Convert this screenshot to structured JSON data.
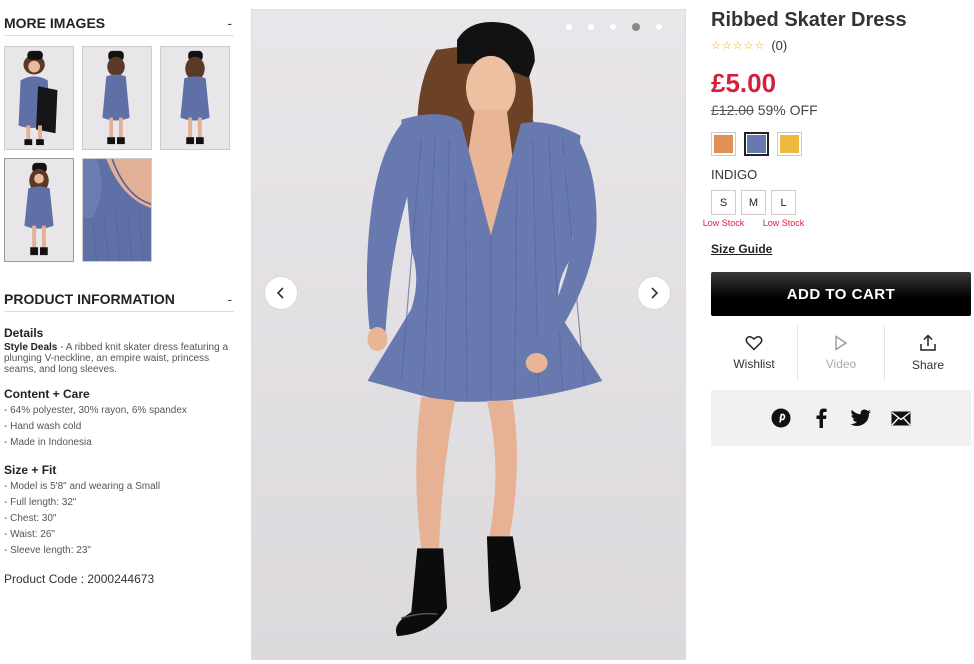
{
  "more_images": {
    "heading": "MORE IMAGES",
    "toggle": "-",
    "thumbnails": [
      "thumb-1",
      "thumb-2",
      "thumb-3",
      "thumb-4",
      "thumb-5"
    ],
    "active_index": 3
  },
  "product_information": {
    "heading": "PRODUCT INFORMATION",
    "toggle": "-",
    "details": {
      "heading": "Details",
      "style_label": "Style Deals",
      "text": " - A ribbed knit skater dress featuring a plunging V-neckline, an empire waist, princess seams, and long sleeves."
    },
    "content_care": {
      "heading": "Content + Care",
      "items": [
        "- 64% polyester, 30% rayon, 6% spandex",
        "- Hand wash cold",
        "- Made in Indonesia"
      ]
    },
    "size_fit": {
      "heading": "Size + Fit",
      "items": [
        "- Model is 5'8\" and wearing a Small",
        "- Full length: 32\"",
        "- Chest: 30\"",
        "- Waist: 26\"",
        "- Sleeve length: 23\""
      ]
    },
    "product_code": "Product Code : 2000244673"
  },
  "gallery": {
    "dot_count": 5,
    "active_dot": 3,
    "prev_icon": "chevron-left-icon",
    "next_icon": "chevron-right-icon"
  },
  "product": {
    "title": "Ribbed Skater Dress",
    "stars": "☆☆☆☆☆",
    "review_count": "(0)",
    "price": "£5.00",
    "original_price": "£12.00",
    "discount": "59% OFF",
    "swatches": [
      {
        "color": "#E08F56",
        "name": "swatch-orange"
      },
      {
        "color": "#6779AE",
        "name": "swatch-indigo",
        "selected": true
      },
      {
        "color": "#EDB940",
        "name": "swatch-mustard"
      }
    ],
    "selected_color": "INDIGO",
    "sizes": [
      {
        "label": "S",
        "stock": "Low Stock"
      },
      {
        "label": "M",
        "stock": ""
      },
      {
        "label": "L",
        "stock": "Low Stock"
      }
    ],
    "size_guide": "Size Guide",
    "add_to_cart": "ADD TO CART"
  },
  "actions": {
    "wishlist": "Wishlist",
    "video": "Video",
    "share": "Share"
  },
  "social": [
    "pinterest-icon",
    "facebook-icon",
    "twitter-icon",
    "email-icon"
  ],
  "colors": {
    "price": "#D91E3C",
    "dress": "#6779AE",
    "background": "#E8E5E9"
  }
}
